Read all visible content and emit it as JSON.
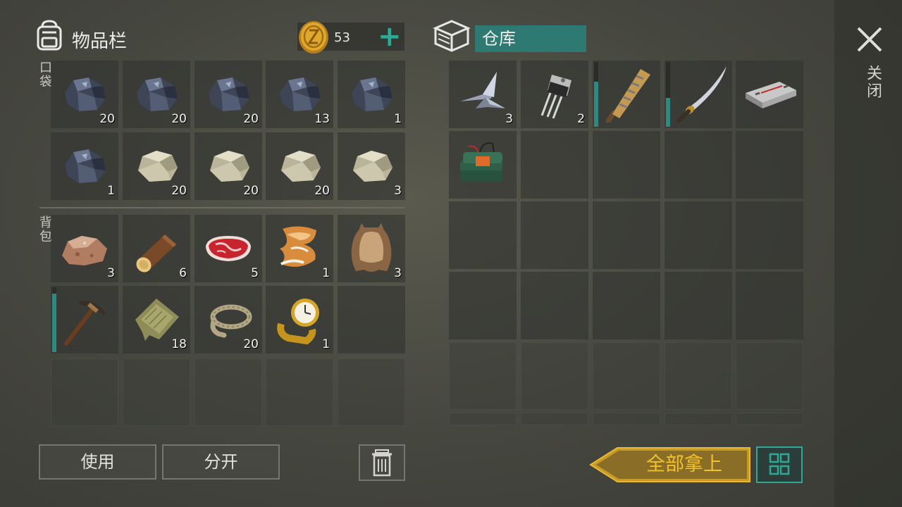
{
  "inventory": {
    "title": "物品栏",
    "coins": "53",
    "pocket_label": "口袋",
    "backpack_label": "背包",
    "pocket_slots": [
      {
        "item": "ore-icon",
        "count": "20"
      },
      {
        "item": "ore-icon",
        "count": "20"
      },
      {
        "item": "ore-icon",
        "count": "20"
      },
      {
        "item": "ore-icon",
        "count": "13"
      },
      {
        "item": "ore-icon",
        "count": "1"
      },
      {
        "item": "ore-icon",
        "count": "1"
      },
      {
        "item": "stone-icon",
        "count": "20"
      },
      {
        "item": "stone-icon",
        "count": "20"
      },
      {
        "item": "stone-icon",
        "count": "20"
      },
      {
        "item": "stone-icon",
        "count": "3"
      }
    ],
    "backpack_slots": [
      {
        "item": "raw-ore-icon",
        "count": "3"
      },
      {
        "item": "log-icon",
        "count": "6"
      },
      {
        "item": "raw-meat-icon",
        "count": "5"
      },
      {
        "item": "fox-fur-icon",
        "count": "1"
      },
      {
        "item": "leather-hide-icon",
        "count": "3"
      },
      {
        "item": "pickaxe-icon",
        "count": "",
        "durability": 0.9
      },
      {
        "item": "cloth-icon",
        "count": "18"
      },
      {
        "item": "rope-icon",
        "count": "20"
      },
      {
        "item": "gold-watch-icon",
        "count": "1"
      }
    ]
  },
  "warehouse": {
    "title": "仓库",
    "slots": [
      {
        "item": "metal-parts-icon",
        "count": "3"
      },
      {
        "item": "transistor-icon",
        "count": "2"
      },
      {
        "item": "nail-bat-icon",
        "count": "",
        "durability": 0.7
      },
      {
        "item": "katana-icon",
        "count": "",
        "durability": 0.45
      },
      {
        "item": "circuit-device-icon",
        "count": ""
      },
      {
        "item": "c4-explosive-icon",
        "count": ""
      }
    ]
  },
  "buttons": {
    "use": "使用",
    "split": "分开",
    "take_all": "全部拿上",
    "close": "关闭"
  },
  "colors": {
    "accent": "#2fa896",
    "take_all_gold": "#f2c22a"
  }
}
